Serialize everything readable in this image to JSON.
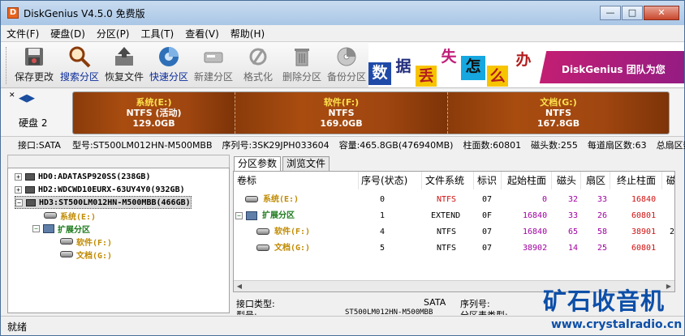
{
  "window": {
    "title": "DiskGenius V4.5.0 免费版",
    "app_icon": "D"
  },
  "menubar": {
    "items": [
      "文件(F)",
      "硬盘(D)",
      "分区(P)",
      "工具(T)",
      "查看(V)",
      "帮助(H)"
    ]
  },
  "toolbar": {
    "buttons": [
      {
        "label": "保存更改",
        "icon": "save-icon"
      },
      {
        "label": "搜索分区",
        "icon": "search-icon"
      },
      {
        "label": "恢复文件",
        "icon": "recover-icon"
      },
      {
        "label": "快速分区",
        "icon": "quick-partition-icon"
      },
      {
        "label": "新建分区",
        "icon": "new-partition-icon"
      },
      {
        "label": "格式化",
        "icon": "format-icon"
      },
      {
        "label": "删除分区",
        "icon": "delete-icon"
      },
      {
        "label": "备份分区",
        "icon": "backup-icon"
      }
    ],
    "banner": {
      "chars": [
        "数",
        "据",
        "丢",
        "失",
        "怎",
        "么",
        "办"
      ],
      "brand": "DiskGenius 团队为您"
    }
  },
  "diskbar": {
    "disk_label": "硬盘 2",
    "partitions": [
      {
        "name": "系统(E:)",
        "fs": "NTFS (活动)",
        "size": "129.0GB"
      },
      {
        "name": "软件(F:)",
        "fs": "NTFS",
        "size": "169.0GB"
      },
      {
        "name": "文档(G:)",
        "fs": "NTFS",
        "size": "167.8GB"
      }
    ]
  },
  "diskinfo": {
    "interface": "接口:SATA",
    "model": "型号:ST500LM012HN-M500MBB",
    "serial": "序列号:3SK29JPH033604",
    "capacity": "容量:465.8GB(476940MB)",
    "cylinders": "柱面数:60801",
    "heads": "磁头数:255",
    "sectors": "每道扇区数:63",
    "total_sectors": "总扇区数"
  },
  "tree": {
    "items": [
      {
        "label": "HD0:ADATASP920SS(238GB)",
        "level": 0
      },
      {
        "label": "HD2:WDCWD10EURX-63UY4Y0(932GB)",
        "level": 0
      },
      {
        "label": "HD3:ST500LM012HN-M500MBB(466GB)",
        "level": 0
      },
      {
        "label": "系统(E:)",
        "level": 1
      },
      {
        "label": "扩展分区",
        "level": 1
      },
      {
        "label": "软件(F:)",
        "level": 2
      },
      {
        "label": "文档(G:)",
        "level": 2
      }
    ]
  },
  "tabs": [
    "分区参数",
    "浏览文件"
  ],
  "table": {
    "headers": [
      "卷标",
      "序号(状态)",
      "文件系统",
      "标识",
      "起始柱面",
      "磁头",
      "扇区",
      "终止柱面",
      "磁"
    ],
    "rows": [
      {
        "label": "系统(E:)",
        "index": "0",
        "fs": "NTFS",
        "id": "07",
        "start_cyl": "0",
        "head": "32",
        "sector": "33",
        "end_cyl": "16840",
        "extra": ""
      },
      {
        "label": "扩展分区",
        "index": "1",
        "fs": "EXTEND",
        "id": "0F",
        "start_cyl": "16840",
        "head": "33",
        "sector": "26",
        "end_cyl": "60801",
        "extra": ""
      },
      {
        "label": "软件(F:)",
        "index": "4",
        "fs": "NTFS",
        "id": "07",
        "start_cyl": "16840",
        "head": "65",
        "sector": "58",
        "end_cyl": "38901",
        "extra": "2"
      },
      {
        "label": "文档(G:)",
        "index": "5",
        "fs": "NTFS",
        "id": "07",
        "start_cyl": "38902",
        "head": "14",
        "sector": "25",
        "end_cyl": "60801",
        "extra": ""
      }
    ]
  },
  "props": {
    "iface_label": "接口类型:",
    "iface_value": "SATA",
    "serial_label": "序列号:",
    "model_label": "型号:",
    "model_value": "ST500LM012HN-M500MBB",
    "ptable_label": "分区表类型:"
  },
  "status": {
    "text": "就绪"
  },
  "watermark": {
    "title": "矿石收音机",
    "url": "www.crystalradio.cn"
  }
}
